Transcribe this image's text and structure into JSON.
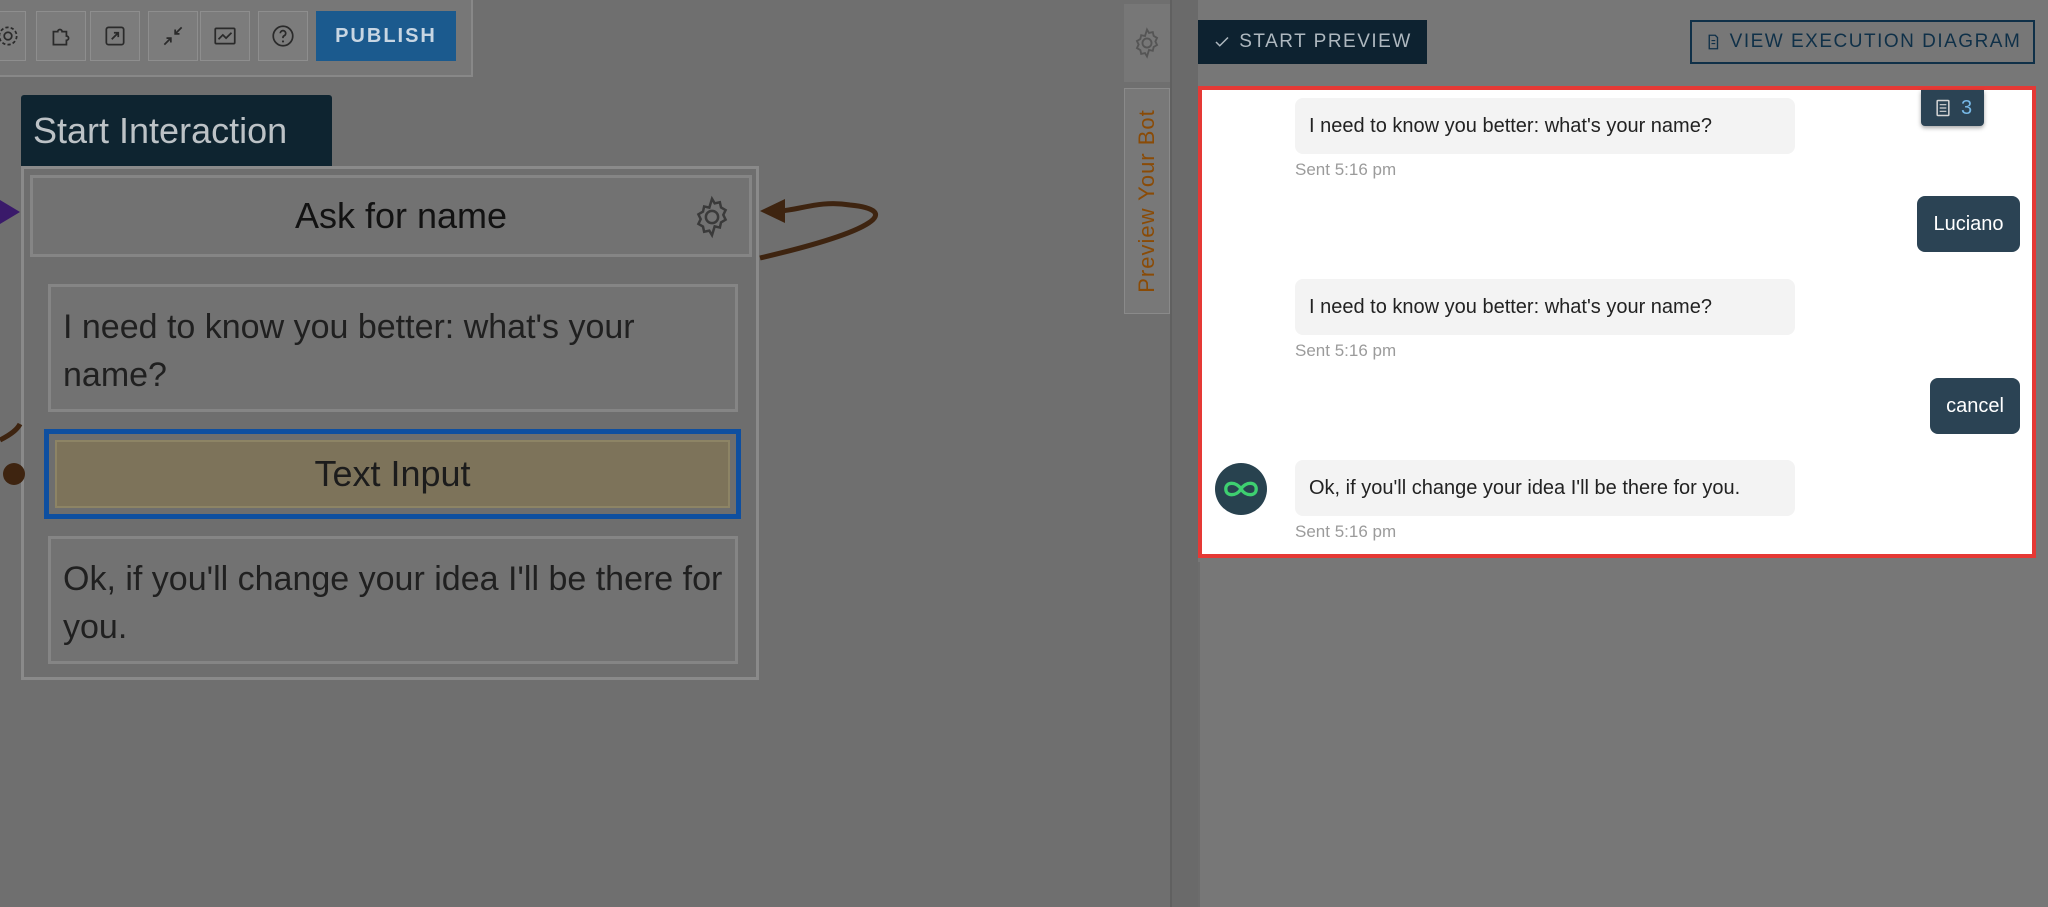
{
  "toolbar": {
    "icons": [
      "gear-icon",
      "puzzle-icon",
      "export-icon",
      "collapse-icon",
      "chart-icon",
      "help-icon"
    ],
    "publish_label": "PUBLISH"
  },
  "flow": {
    "start_label": "Start Interaction",
    "node_title": "Ask for name",
    "question_text": "I need to know you better: what's your name?",
    "input_label": "Text Input",
    "cancel_text": "Ok, if you'll change your idea I'll be there for you."
  },
  "side_tab": {
    "label": "Preview Your Bot"
  },
  "preview": {
    "start_preview_label": "START PREVIEW",
    "view_diagram_label": "VIEW EXECUTION DIAGRAM",
    "badge_count": "3",
    "messages": [
      {
        "from": "bot",
        "text": "I need to know you better: what's your name?",
        "time": "Sent 5:16 pm"
      },
      {
        "from": "user",
        "text": "Luciano"
      },
      {
        "from": "bot",
        "text": "I need to know you better: what's your name?",
        "time": "Sent 5:16 pm"
      },
      {
        "from": "user",
        "text": "cancel"
      },
      {
        "from": "bot",
        "text": "Ok, if you'll change your idea I'll be there for you.",
        "time": "Sent 5:16 pm"
      }
    ]
  },
  "colors": {
    "accent": "#1b5a8e",
    "dark_navy": "#0d2230",
    "bubble_user": "#2b4354",
    "highlight_border": "#e53935",
    "avatar_logo": "#3ecf70"
  }
}
